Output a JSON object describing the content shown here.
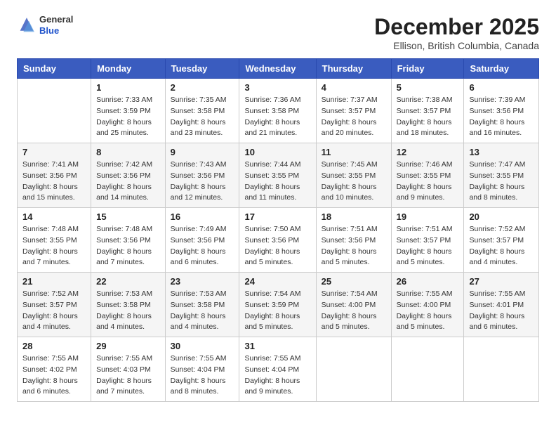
{
  "header": {
    "logo_general": "General",
    "logo_blue": "Blue",
    "month": "December 2025",
    "location": "Ellison, British Columbia, Canada"
  },
  "days_of_week": [
    "Sunday",
    "Monday",
    "Tuesday",
    "Wednesday",
    "Thursday",
    "Friday",
    "Saturday"
  ],
  "weeks": [
    [
      {
        "day": "",
        "info": ""
      },
      {
        "day": "1",
        "info": "Sunrise: 7:33 AM\nSunset: 3:59 PM\nDaylight: 8 hours\nand 25 minutes."
      },
      {
        "day": "2",
        "info": "Sunrise: 7:35 AM\nSunset: 3:58 PM\nDaylight: 8 hours\nand 23 minutes."
      },
      {
        "day": "3",
        "info": "Sunrise: 7:36 AM\nSunset: 3:58 PM\nDaylight: 8 hours\nand 21 minutes."
      },
      {
        "day": "4",
        "info": "Sunrise: 7:37 AM\nSunset: 3:57 PM\nDaylight: 8 hours\nand 20 minutes."
      },
      {
        "day": "5",
        "info": "Sunrise: 7:38 AM\nSunset: 3:57 PM\nDaylight: 8 hours\nand 18 minutes."
      },
      {
        "day": "6",
        "info": "Sunrise: 7:39 AM\nSunset: 3:56 PM\nDaylight: 8 hours\nand 16 minutes."
      }
    ],
    [
      {
        "day": "7",
        "info": "Sunrise: 7:41 AM\nSunset: 3:56 PM\nDaylight: 8 hours\nand 15 minutes."
      },
      {
        "day": "8",
        "info": "Sunrise: 7:42 AM\nSunset: 3:56 PM\nDaylight: 8 hours\nand 14 minutes."
      },
      {
        "day": "9",
        "info": "Sunrise: 7:43 AM\nSunset: 3:56 PM\nDaylight: 8 hours\nand 12 minutes."
      },
      {
        "day": "10",
        "info": "Sunrise: 7:44 AM\nSunset: 3:55 PM\nDaylight: 8 hours\nand 11 minutes."
      },
      {
        "day": "11",
        "info": "Sunrise: 7:45 AM\nSunset: 3:55 PM\nDaylight: 8 hours\nand 10 minutes."
      },
      {
        "day": "12",
        "info": "Sunrise: 7:46 AM\nSunset: 3:55 PM\nDaylight: 8 hours\nand 9 minutes."
      },
      {
        "day": "13",
        "info": "Sunrise: 7:47 AM\nSunset: 3:55 PM\nDaylight: 8 hours\nand 8 minutes."
      }
    ],
    [
      {
        "day": "14",
        "info": "Sunrise: 7:48 AM\nSunset: 3:55 PM\nDaylight: 8 hours\nand 7 minutes."
      },
      {
        "day": "15",
        "info": "Sunrise: 7:48 AM\nSunset: 3:56 PM\nDaylight: 8 hours\nand 7 minutes."
      },
      {
        "day": "16",
        "info": "Sunrise: 7:49 AM\nSunset: 3:56 PM\nDaylight: 8 hours\nand 6 minutes."
      },
      {
        "day": "17",
        "info": "Sunrise: 7:50 AM\nSunset: 3:56 PM\nDaylight: 8 hours\nand 5 minutes."
      },
      {
        "day": "18",
        "info": "Sunrise: 7:51 AM\nSunset: 3:56 PM\nDaylight: 8 hours\nand 5 minutes."
      },
      {
        "day": "19",
        "info": "Sunrise: 7:51 AM\nSunset: 3:57 PM\nDaylight: 8 hours\nand 5 minutes."
      },
      {
        "day": "20",
        "info": "Sunrise: 7:52 AM\nSunset: 3:57 PM\nDaylight: 8 hours\nand 4 minutes."
      }
    ],
    [
      {
        "day": "21",
        "info": "Sunrise: 7:52 AM\nSunset: 3:57 PM\nDaylight: 8 hours\nand 4 minutes."
      },
      {
        "day": "22",
        "info": "Sunrise: 7:53 AM\nSunset: 3:58 PM\nDaylight: 8 hours\nand 4 minutes."
      },
      {
        "day": "23",
        "info": "Sunrise: 7:53 AM\nSunset: 3:58 PM\nDaylight: 8 hours\nand 4 minutes."
      },
      {
        "day": "24",
        "info": "Sunrise: 7:54 AM\nSunset: 3:59 PM\nDaylight: 8 hours\nand 5 minutes."
      },
      {
        "day": "25",
        "info": "Sunrise: 7:54 AM\nSunset: 4:00 PM\nDaylight: 8 hours\nand 5 minutes."
      },
      {
        "day": "26",
        "info": "Sunrise: 7:55 AM\nSunset: 4:00 PM\nDaylight: 8 hours\nand 5 minutes."
      },
      {
        "day": "27",
        "info": "Sunrise: 7:55 AM\nSunset: 4:01 PM\nDaylight: 8 hours\nand 6 minutes."
      }
    ],
    [
      {
        "day": "28",
        "info": "Sunrise: 7:55 AM\nSunset: 4:02 PM\nDaylight: 8 hours\nand 6 minutes."
      },
      {
        "day": "29",
        "info": "Sunrise: 7:55 AM\nSunset: 4:03 PM\nDaylight: 8 hours\nand 7 minutes."
      },
      {
        "day": "30",
        "info": "Sunrise: 7:55 AM\nSunset: 4:04 PM\nDaylight: 8 hours\nand 8 minutes."
      },
      {
        "day": "31",
        "info": "Sunrise: 7:55 AM\nSunset: 4:04 PM\nDaylight: 8 hours\nand 9 minutes."
      },
      {
        "day": "",
        "info": ""
      },
      {
        "day": "",
        "info": ""
      },
      {
        "day": "",
        "info": ""
      }
    ]
  ]
}
